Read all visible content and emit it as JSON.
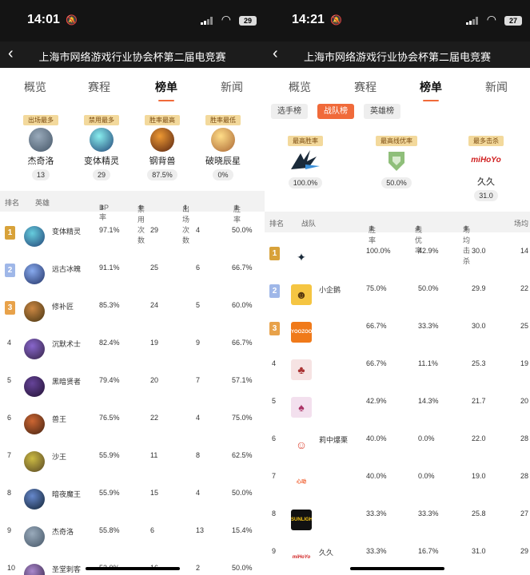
{
  "left": {
    "status": {
      "time": "14:01",
      "battery": "29"
    },
    "nav_title": "上海市网络游戏行业协会杯第二届电竞赛",
    "tabs": [
      "概览",
      "赛程",
      "榜单",
      "新闻"
    ],
    "stats": [
      {
        "label": "出场最多",
        "name": "杰奇洛",
        "value": "13"
      },
      {
        "label": "禁用最多",
        "name": "变体精灵",
        "value": "29"
      },
      {
        "label": "胜率最高",
        "name": "钢背兽",
        "value": "87.5%"
      },
      {
        "label": "胜率最低",
        "name": "破晓辰星",
        "value": "0%"
      }
    ],
    "headers": [
      "排名",
      "英雄",
      "BP率",
      "禁用次数",
      "出场次数",
      "胜率"
    ],
    "rows": [
      {
        "rank": "1",
        "hero": "变体精灵",
        "bp": "97.1%",
        "ban": "29",
        "pick": "4",
        "win": "50.0%"
      },
      {
        "rank": "2",
        "hero": "远古冰魄",
        "bp": "91.1%",
        "ban": "25",
        "pick": "6",
        "win": "66.7%"
      },
      {
        "rank": "3",
        "hero": "修补匠",
        "bp": "85.3%",
        "ban": "24",
        "pick": "5",
        "win": "60.0%"
      },
      {
        "rank": "4",
        "hero": "沉默术士",
        "bp": "82.4%",
        "ban": "19",
        "pick": "9",
        "win": "66.7%"
      },
      {
        "rank": "5",
        "hero": "黑暗贤者",
        "bp": "79.4%",
        "ban": "20",
        "pick": "7",
        "win": "57.1%"
      },
      {
        "rank": "6",
        "hero": "兽王",
        "bp": "76.5%",
        "ban": "22",
        "pick": "4",
        "win": "75.0%"
      },
      {
        "rank": "7",
        "hero": "沙王",
        "bp": "55.9%",
        "ban": "11",
        "pick": "8",
        "win": "62.5%"
      },
      {
        "rank": "8",
        "hero": "暗夜魔王",
        "bp": "55.9%",
        "ban": "15",
        "pick": "4",
        "win": "50.0%"
      },
      {
        "rank": "9",
        "hero": "杰奇洛",
        "bp": "55.8%",
        "ban": "6",
        "pick": "13",
        "win": "15.4%"
      },
      {
        "rank": "10",
        "hero": "圣堂刺客",
        "bp": "53.0%",
        "ban": "16",
        "pick": "2",
        "win": "50.0%"
      }
    ]
  },
  "right": {
    "status": {
      "time": "14:21",
      "battery": "27"
    },
    "nav_title": "上海市网络游戏行业协会杯第二届电竞赛",
    "tabs": [
      "概览",
      "赛程",
      "榜单",
      "新闻"
    ],
    "chips": [
      "选手榜",
      "战队榜",
      "英雄榜"
    ],
    "stats": [
      {
        "label": "最高胜率",
        "name": "",
        "value": "100.0%"
      },
      {
        "label": "最高线优率",
        "name": "",
        "value": "50.0%"
      },
      {
        "label": "最多击杀",
        "name": "久久",
        "value": "31.0",
        "logo_text": "miHoYo"
      }
    ],
    "headers": [
      "排名",
      "战队",
      "胜率",
      "线优率",
      "场均击杀",
      "场均"
    ],
    "rows": [
      {
        "rank": "1",
        "team": "",
        "win": "100.0%",
        "lane": "42.9%",
        "kills": "30.0",
        "extra": "14"
      },
      {
        "rank": "2",
        "team": "小企鹅",
        "win": "75.0%",
        "lane": "50.0%",
        "kills": "29.9",
        "extra": "22"
      },
      {
        "rank": "3",
        "team": "",
        "logo_text": "YOOZOO",
        "win": "66.7%",
        "lane": "33.3%",
        "kills": "30.0",
        "extra": "25"
      },
      {
        "rank": "4",
        "team": "",
        "win": "66.7%",
        "lane": "11.1%",
        "kills": "25.3",
        "extra": "19"
      },
      {
        "rank": "5",
        "team": "",
        "win": "42.9%",
        "lane": "14.3%",
        "kills": "21.7",
        "extra": "20"
      },
      {
        "rank": "6",
        "team": "莉中爆栗",
        "win": "40.0%",
        "lane": "0.0%",
        "kills": "22.0",
        "extra": "28"
      },
      {
        "rank": "7",
        "team": "",
        "logo_text": "心动",
        "win": "40.0%",
        "lane": "0.0%",
        "kills": "19.0",
        "extra": "28"
      },
      {
        "rank": "8",
        "team": "",
        "logo_text": "SUNLIGHT",
        "win": "33.3%",
        "lane": "33.3%",
        "kills": "25.8",
        "extra": "27"
      },
      {
        "rank": "9",
        "team": "久久",
        "logo_text": "miHoYo",
        "win": "33.3%",
        "lane": "16.7%",
        "kills": "31.0",
        "extra": "29"
      }
    ]
  },
  "icons": {
    "back": "chevron-left-icon",
    "sort": "sort-icon",
    "mute": "bell-slash-icon",
    "wifi": "wifi-icon"
  },
  "colors": {
    "accent": "#f06a3a",
    "gold": "#d8a23a",
    "silver": "#9fb7e8",
    "bronze": "#e8a24a",
    "label_bg": "#f3d99c"
  }
}
